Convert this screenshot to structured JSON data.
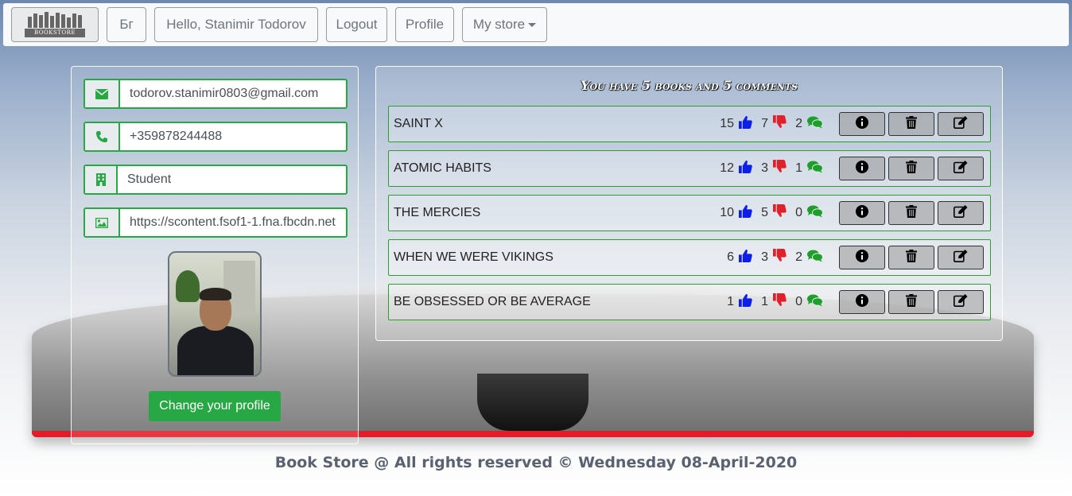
{
  "navbar": {
    "logo_text": "BOOKSTORE",
    "language_label": "Бг",
    "greeting": "Hello, Stanimir Todorov",
    "logout_label": "Logout",
    "profile_label": "Profile",
    "my_store_label": "My store"
  },
  "profile": {
    "email": "todorov.stanimir0803@gmail.com",
    "phone": "+359878244488",
    "occupation": "Student",
    "image_url": "https://scontent.fsof1-1.fna.fbcdn.net",
    "change_button": "Change your profile",
    "icons": [
      "envelope-icon",
      "phone-icon",
      "building-icon",
      "image-icon"
    ]
  },
  "summary": "You have 5 books and 5 comments",
  "books": [
    {
      "title": "SAINT X",
      "likes": "15",
      "dislikes": "7",
      "comments": "2"
    },
    {
      "title": "ATOMIC HABITS",
      "likes": "12",
      "dislikes": "3",
      "comments": "1"
    },
    {
      "title": "THE MERCIES",
      "likes": "10",
      "dislikes": "5",
      "comments": "0"
    },
    {
      "title": "WHEN WE WERE VIKINGS",
      "likes": "6",
      "dislikes": "3",
      "comments": "2"
    },
    {
      "title": "BE OBSESSED OR BE AVERAGE",
      "likes": "1",
      "dislikes": "1",
      "comments": "0"
    }
  ],
  "footer": "Book Store @ All rights reserved © Wednesday 08-April-2020",
  "colors": {
    "accent_green": "#28a745",
    "like_blue": "#0d1ee8",
    "dislike_red": "#e0202a",
    "comment_green": "#1e9e2a"
  }
}
